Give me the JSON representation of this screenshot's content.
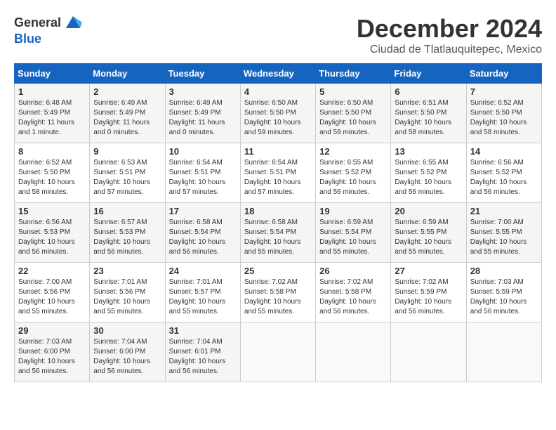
{
  "header": {
    "logo_general": "General",
    "logo_blue": "Blue",
    "month_year": "December 2024",
    "location": "Ciudad de Tlatlauquitepec, Mexico"
  },
  "weekdays": [
    "Sunday",
    "Monday",
    "Tuesday",
    "Wednesday",
    "Thursday",
    "Friday",
    "Saturday"
  ],
  "weeks": [
    [
      {
        "day": "1",
        "sunrise": "6:48 AM",
        "sunset": "5:49 PM",
        "daylight": "11 hours and 1 minute."
      },
      {
        "day": "2",
        "sunrise": "6:49 AM",
        "sunset": "5:49 PM",
        "daylight": "11 hours and 0 minutes."
      },
      {
        "day": "3",
        "sunrise": "6:49 AM",
        "sunset": "5:49 PM",
        "daylight": "11 hours and 0 minutes."
      },
      {
        "day": "4",
        "sunrise": "6:50 AM",
        "sunset": "5:50 PM",
        "daylight": "10 hours and 59 minutes."
      },
      {
        "day": "5",
        "sunrise": "6:50 AM",
        "sunset": "5:50 PM",
        "daylight": "10 hours and 59 minutes."
      },
      {
        "day": "6",
        "sunrise": "6:51 AM",
        "sunset": "5:50 PM",
        "daylight": "10 hours and 58 minutes."
      },
      {
        "day": "7",
        "sunrise": "6:52 AM",
        "sunset": "5:50 PM",
        "daylight": "10 hours and 58 minutes."
      }
    ],
    [
      {
        "day": "8",
        "sunrise": "6:52 AM",
        "sunset": "5:50 PM",
        "daylight": "10 hours and 58 minutes."
      },
      {
        "day": "9",
        "sunrise": "6:53 AM",
        "sunset": "5:51 PM",
        "daylight": "10 hours and 57 minutes."
      },
      {
        "day": "10",
        "sunrise": "6:54 AM",
        "sunset": "5:51 PM",
        "daylight": "10 hours and 57 minutes."
      },
      {
        "day": "11",
        "sunrise": "6:54 AM",
        "sunset": "5:51 PM",
        "daylight": "10 hours and 57 minutes."
      },
      {
        "day": "12",
        "sunrise": "6:55 AM",
        "sunset": "5:52 PM",
        "daylight": "10 hours and 56 minutes."
      },
      {
        "day": "13",
        "sunrise": "6:55 AM",
        "sunset": "5:52 PM",
        "daylight": "10 hours and 56 minutes."
      },
      {
        "day": "14",
        "sunrise": "6:56 AM",
        "sunset": "5:52 PM",
        "daylight": "10 hours and 56 minutes."
      }
    ],
    [
      {
        "day": "15",
        "sunrise": "6:56 AM",
        "sunset": "5:53 PM",
        "daylight": "10 hours and 56 minutes."
      },
      {
        "day": "16",
        "sunrise": "6:57 AM",
        "sunset": "5:53 PM",
        "daylight": "10 hours and 56 minutes."
      },
      {
        "day": "17",
        "sunrise": "6:58 AM",
        "sunset": "5:54 PM",
        "daylight": "10 hours and 56 minutes."
      },
      {
        "day": "18",
        "sunrise": "6:58 AM",
        "sunset": "5:54 PM",
        "daylight": "10 hours and 55 minutes."
      },
      {
        "day": "19",
        "sunrise": "6:59 AM",
        "sunset": "5:54 PM",
        "daylight": "10 hours and 55 minutes."
      },
      {
        "day": "20",
        "sunrise": "6:59 AM",
        "sunset": "5:55 PM",
        "daylight": "10 hours and 55 minutes."
      },
      {
        "day": "21",
        "sunrise": "7:00 AM",
        "sunset": "5:55 PM",
        "daylight": "10 hours and 55 minutes."
      }
    ],
    [
      {
        "day": "22",
        "sunrise": "7:00 AM",
        "sunset": "5:56 PM",
        "daylight": "10 hours and 55 minutes."
      },
      {
        "day": "23",
        "sunrise": "7:01 AM",
        "sunset": "5:56 PM",
        "daylight": "10 hours and 55 minutes."
      },
      {
        "day": "24",
        "sunrise": "7:01 AM",
        "sunset": "5:57 PM",
        "daylight": "10 hours and 55 minutes."
      },
      {
        "day": "25",
        "sunrise": "7:02 AM",
        "sunset": "5:58 PM",
        "daylight": "10 hours and 55 minutes."
      },
      {
        "day": "26",
        "sunrise": "7:02 AM",
        "sunset": "5:58 PM",
        "daylight": "10 hours and 56 minutes."
      },
      {
        "day": "27",
        "sunrise": "7:02 AM",
        "sunset": "5:59 PM",
        "daylight": "10 hours and 56 minutes."
      },
      {
        "day": "28",
        "sunrise": "7:03 AM",
        "sunset": "5:59 PM",
        "daylight": "10 hours and 56 minutes."
      }
    ],
    [
      {
        "day": "29",
        "sunrise": "7:03 AM",
        "sunset": "6:00 PM",
        "daylight": "10 hours and 56 minutes."
      },
      {
        "day": "30",
        "sunrise": "7:04 AM",
        "sunset": "6:00 PM",
        "daylight": "10 hours and 56 minutes."
      },
      {
        "day": "31",
        "sunrise": "7:04 AM",
        "sunset": "6:01 PM",
        "daylight": "10 hours and 56 minutes."
      },
      null,
      null,
      null,
      null
    ]
  ]
}
